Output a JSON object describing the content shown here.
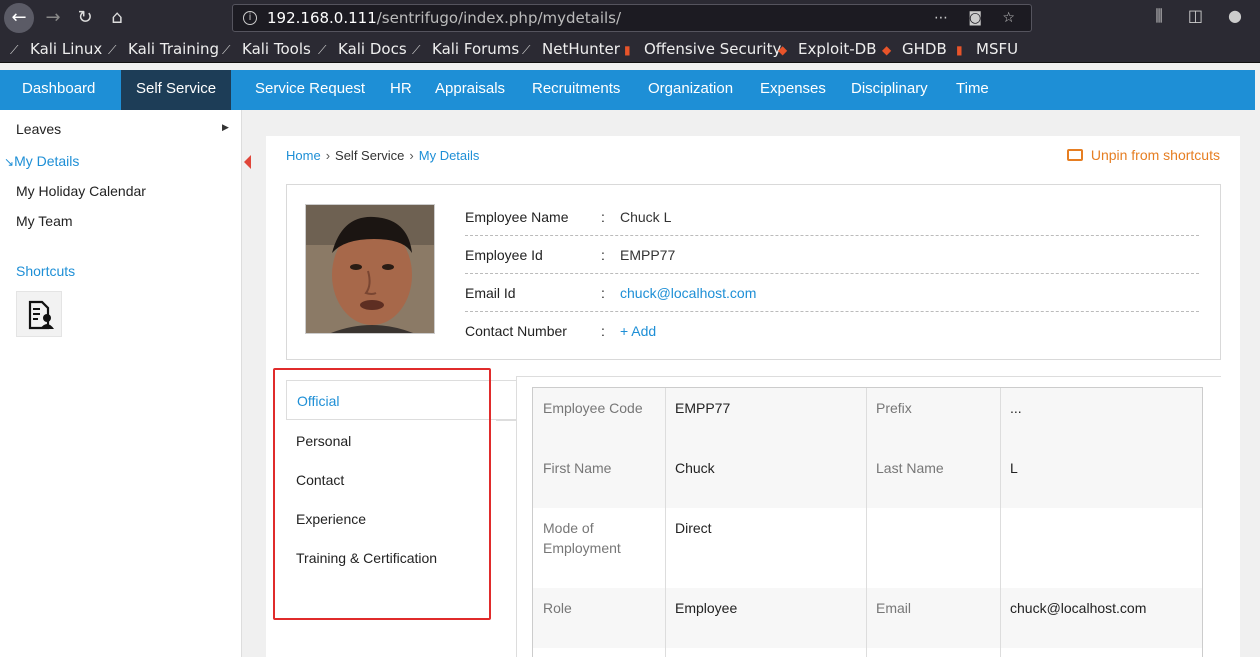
{
  "browser": {
    "url_host": "192.168.0.111",
    "url_path": "/sentrifugo/index.php/mydetails/",
    "bookmarks": [
      "Kali Linux",
      "Kali Training",
      "Kali Tools",
      "Kali Docs",
      "Kali Forums",
      "NetHunter",
      "Offensive Security",
      "Exploit-DB",
      "GHDB",
      "MSFU"
    ]
  },
  "nav": {
    "items": [
      "Dashboard",
      "Self Service",
      "Service Request",
      "HR",
      "Appraisals",
      "Recruitments",
      "Organization",
      "Expenses",
      "Disciplinary",
      "Time"
    ],
    "active": "Self Service"
  },
  "sidebar": {
    "items": [
      "Leaves",
      "My Details",
      "My Holiday Calendar",
      "My Team"
    ],
    "active": "My Details",
    "shortcuts_title": "Shortcuts"
  },
  "breadcrumb": {
    "home": "Home",
    "section": "Self Service",
    "current": "My Details",
    "separator": "›"
  },
  "unpin_label": "Unpin from shortcuts",
  "profile": {
    "rows": [
      {
        "label": "Employee Name",
        "value": "Chuck L"
      },
      {
        "label": "Employee Id",
        "value": "EMPP77"
      },
      {
        "label": "Email Id",
        "value": "chuck@localhost.com"
      },
      {
        "label": "Contact Number",
        "value": "+ Add"
      }
    ],
    "colon": ":"
  },
  "tabs": [
    "Official",
    "Personal",
    "Contact",
    "Experience",
    "Training & Certification"
  ],
  "active_tab": "Official",
  "details": {
    "rows": [
      {
        "l1": "Employee Code",
        "v1": "EMPP77",
        "l2": "Prefix",
        "v2": "..."
      },
      {
        "l1": "First Name",
        "v1": "Chuck",
        "l2": "Last Name",
        "v2": "L"
      },
      {
        "l1": "Mode of Employment",
        "v1": "Direct",
        "l2": "",
        "v2": ""
      },
      {
        "l1": "Role",
        "v1": "Employee",
        "l2": "Email",
        "v2": "chuck@localhost.com"
      }
    ]
  },
  "colors": {
    "nav_bg": "#1e8fd6",
    "nav_active_bg": "#1d3d57",
    "link": "#1e8fd6",
    "unpin": "#e67e22",
    "highlight": "#e02b2b"
  }
}
